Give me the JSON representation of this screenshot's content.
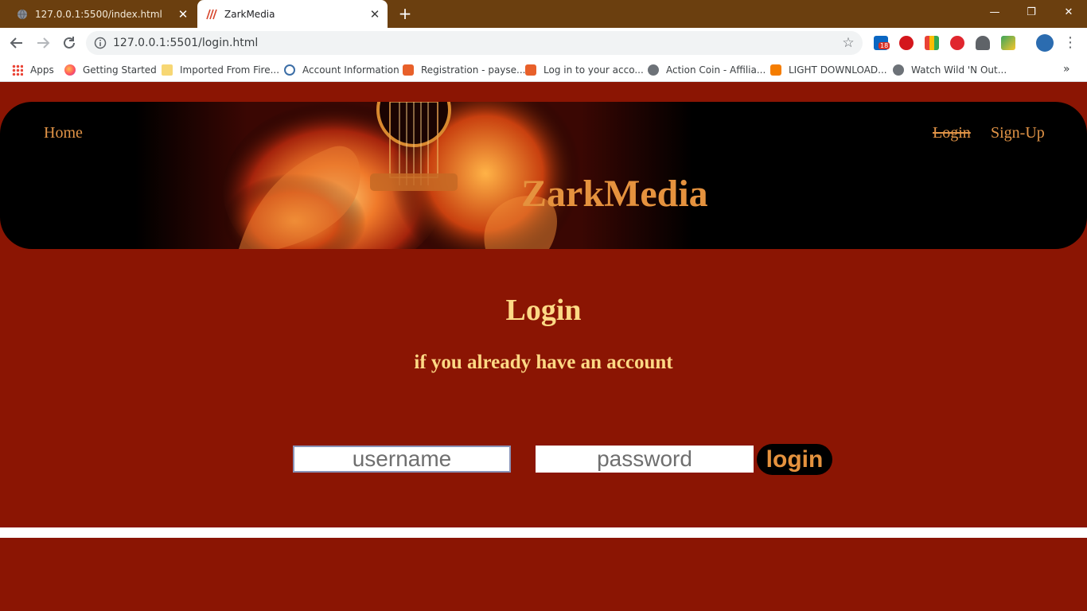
{
  "browser": {
    "tabs": [
      {
        "title": "127.0.0.1:5500/index.html",
        "favicon": "globe-icon"
      },
      {
        "title": "ZarkMedia",
        "favicon": "zark-favicon-icon"
      }
    ],
    "new_tab_symbol": "+",
    "close_symbol": "✕",
    "url": "127.0.0.1:5501/login.html",
    "bookmarks": [
      {
        "label": "Apps",
        "icon": "apps-grid-icon"
      },
      {
        "label": "Getting Started",
        "icon": "firefox-icon"
      },
      {
        "label": "Imported From Fire...",
        "icon": "folder-icon"
      },
      {
        "label": "Account Information",
        "icon": "account-icon"
      },
      {
        "label": "Registration - payse...",
        "icon": "payseal-icon"
      },
      {
        "label": "Log in to your acco...",
        "icon": "payseal-icon"
      },
      {
        "label": "Action Coin - Affilia...",
        "icon": "globe-icon"
      },
      {
        "label": "LIGHT DOWNLOAD...",
        "icon": "blogger-icon"
      },
      {
        "label": "Watch Wild 'N Out...",
        "icon": "globe-icon"
      }
    ],
    "extension_badge": "18",
    "more_bookmarks": "»"
  },
  "site": {
    "nav": {
      "home": "Home",
      "login": "Login",
      "signup": "Sign-Up"
    },
    "brand": "ZarkMedia",
    "heading": "Login",
    "subheading": "if you already have an account",
    "form": {
      "username_placeholder": "username",
      "password_placeholder": "password",
      "submit_label": "login"
    }
  },
  "colors": {
    "page_bg": "#8b1503",
    "accent": "#e5923e",
    "heading": "#fdd985",
    "tabstrip": "#6b3f0f"
  }
}
